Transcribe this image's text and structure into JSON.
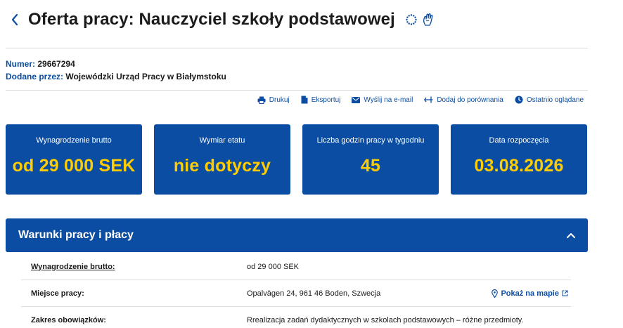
{
  "header": {
    "title": "Oferta pracy: Nauczyciel szkoły podstawowej",
    "icons": [
      "back-chevron-icon",
      "eu-stars-icon",
      "accessibility-hand-icon"
    ]
  },
  "meta": {
    "number_label": "Numer:",
    "number_value": "29667294",
    "added_label": "Dodane przez:",
    "added_value": "Wojewódzki Urząd Pracy w Białymstoku"
  },
  "actions": [
    {
      "label": "Drukuj",
      "icon": "printer-icon"
    },
    {
      "label": "Eksportuj",
      "icon": "document-icon"
    },
    {
      "label": "Wyślij na e-mail",
      "icon": "envelope-icon"
    },
    {
      "label": "Dodaj do porównania",
      "icon": "compare-icon"
    },
    {
      "label": "Ostatnio oglądane",
      "icon": "clock-icon"
    }
  ],
  "cards": [
    {
      "label": "Wynagrodzenie brutto",
      "value": "od 29 000 SEK"
    },
    {
      "label": "Wymiar etatu",
      "value": "nie dotyczy"
    },
    {
      "label": "Liczba godzin pracy w tygodniu",
      "value": "45"
    },
    {
      "label": "Data rozpoczęcia",
      "value": "03.08.2026"
    }
  ],
  "accordion": {
    "title": "Warunki pracy i płacy",
    "expanded": true
  },
  "details": [
    {
      "key": "Wynagrodzenie brutto:",
      "value": "od 29 000 SEK"
    },
    {
      "key": "Miejsce pracy:",
      "value": "Opalvägen 24, 961 46  Boden, Szwecja",
      "link": "Pokaż na mapie"
    },
    {
      "key": "Zakres obowiązków:",
      "value": "Rrealizacja zadań dydaktycznych w szkolach podstawowych – różne przedmioty."
    }
  ],
  "colors": {
    "primary": "#0b4da2",
    "accent": "#ffcc00",
    "text": "#1b1b1b",
    "divider": "#dcdcdc"
  }
}
